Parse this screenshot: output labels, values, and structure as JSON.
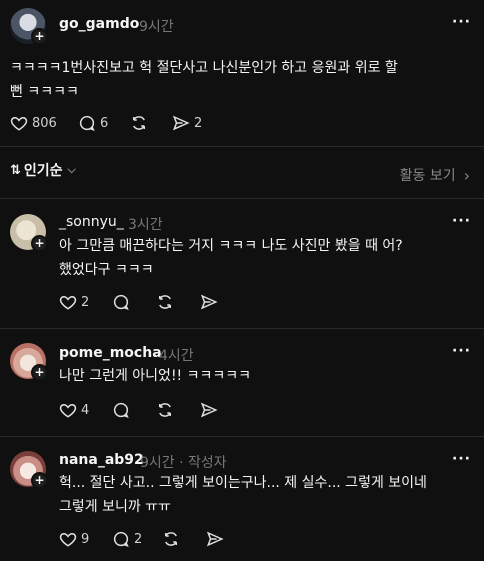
{
  "post": {
    "username": "go_gamdo",
    "time": "9시간",
    "lines": [
      "ㅋㅋㅋㅋ1번사진보고 헉 절단사고 나신분인가 하고 응원과 위로 할",
      "뻔 ㅋㅋㅋㅋ"
    ],
    "likes": "806",
    "comments": "6",
    "shares": "2"
  },
  "sort": {
    "label": "인기순",
    "view_all": "활동 보기"
  },
  "replies": [
    {
      "username": "_sonnyu_",
      "time": "3시간",
      "lines": [
        "아 그만큼 매끈하다는 거지 ㅋㅋㅋ 나도 사진만 봤을 때 어?",
        "했었다구 ㅋㅋㅋ"
      ],
      "likes": "2",
      "comments": ""
    },
    {
      "username": "pome_mocha",
      "time": "4시간",
      "lines": [
        "나만 그런게 아니었!! ㅋㅋㅋㅋㅋ"
      ],
      "likes": "4",
      "comments": ""
    },
    {
      "username": "nana_ab92",
      "time": "9시간 · 작성자",
      "lines": [
        "헉... 절단 사고.. 그렇게 보이는구나... 제 실수... 그렇게 보이네",
        "그렇게 보니까 ㅠㅠ"
      ],
      "likes": "9",
      "comments": "2"
    }
  ]
}
